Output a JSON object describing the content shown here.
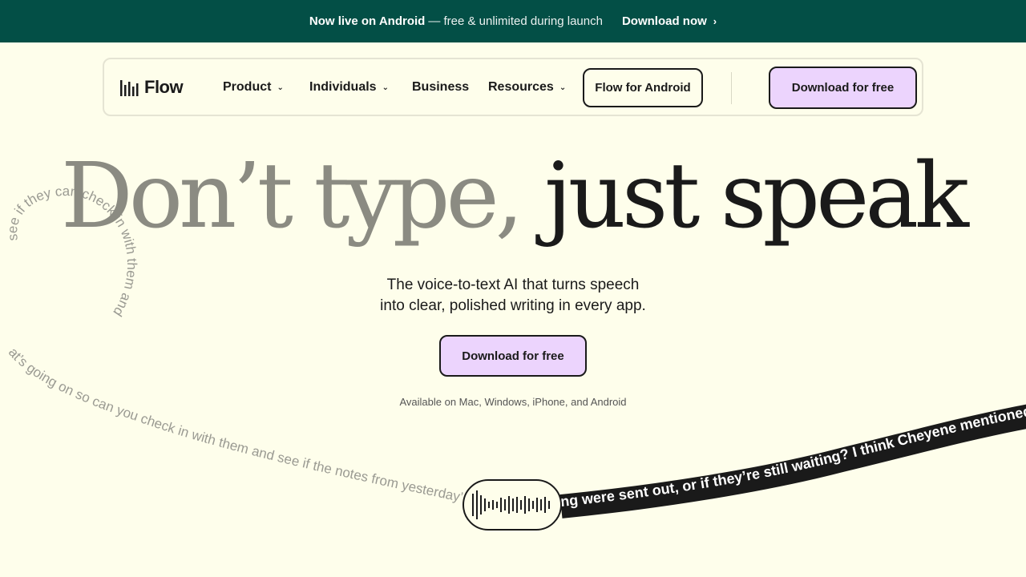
{
  "announcement": {
    "bold": "Now live on Android",
    "rest": "— free & unlimited during launch",
    "link": "Download now",
    "link_icon": "chevron-right-icon"
  },
  "nav": {
    "logo_text": "Flow",
    "logo_icon": "waveform-bars-icon",
    "items": [
      {
        "label": "Product",
        "has_dropdown": true
      },
      {
        "label": "Individuals",
        "has_dropdown": true
      },
      {
        "label": "Business",
        "has_dropdown": false
      },
      {
        "label": "Resources",
        "has_dropdown": true
      }
    ],
    "android_button": "Flow for Android",
    "download_button": "Download for free"
  },
  "hero": {
    "title_part1": "Don’t type,",
    "title_part2": "just speak",
    "subtitle_line1": "The voice-to-text AI that turns speech",
    "subtitle_line2": "into clear, polished writing in every app.",
    "cta": "Download for free",
    "availability": "Available on Mac, Windows, iPhone, and Android"
  },
  "swirl": {
    "raw_text_loop": "see if the notes from yesterday's meeting were sent out, or if they're still waiting. I think Ch",
    "raw_text_top": "and see if they can check in with them and",
    "raw_text_loop2": "at's going on so can you check in with them and see if the notes from yesterday's meeting were sent out, or if they're still waiting. I think Ch",
    "polished_text": "ng were sent out, or if they’re still waiting? I think Cheyene mentioned"
  },
  "colors": {
    "announcement_bg": "#034f46",
    "page_bg": "#fefeeb",
    "accent_lavender": "#ecd4fd",
    "text_dark": "#1a1a1a",
    "text_grey": "#8b8b82"
  }
}
